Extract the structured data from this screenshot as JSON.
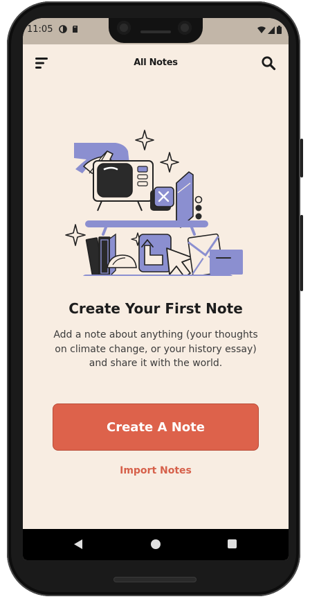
{
  "status_bar": {
    "time": "11:05"
  },
  "app_bar": {
    "title": "All Notes",
    "menu_icon": "hamburger-menu-icon",
    "search_icon": "search-icon"
  },
  "empty_state": {
    "heading": "Create Your First Note",
    "description": "Add a note about anything (your thoughts on climate change, or your history essay) and share it with the world.",
    "primary_action": "Create A Note",
    "secondary_action": "Import Notes"
  },
  "colors": {
    "background": "#f8ede2",
    "accent": "#dd624b",
    "illustration": "#8b8fd0",
    "status_bar": "#c2b6a8"
  },
  "nav_bar": {
    "icons": [
      "back-icon",
      "home-icon",
      "recents-icon"
    ]
  }
}
